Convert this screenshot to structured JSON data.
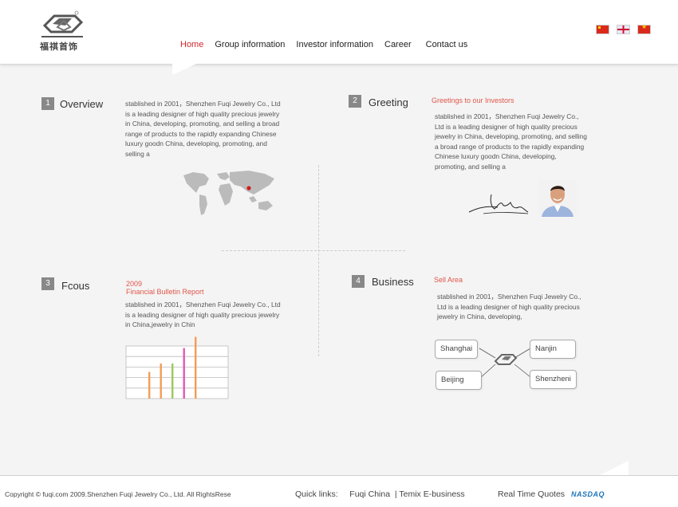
{
  "header": {
    "logo_text": "福祺首饰",
    "nav": [
      "Home",
      "Group information",
      "Investor information",
      "Career",
      "Contact us"
    ],
    "active_nav": "Home",
    "flags": [
      "china-flag-icon",
      "uk-flag-icon",
      "vietnam-flag-icon"
    ]
  },
  "sections": {
    "overview": {
      "number": "1",
      "title": "Overview",
      "text": "stablished in 2001，Shenzhen Fuqi Jewelry Co., Ltd is a leading designer of high quality precious jewelry in China, developing, promoting, and selling a broad range of products to the rapidly expanding Chinese luxury goodn China, developing, promoting, and selling a"
    },
    "greeting": {
      "number": "2",
      "title": "Greeting",
      "subtitle": "Greetings to our Investors",
      "text": "stablished in 2001，Shenzhen Fuqi Jewelry Co., Ltd is a leading designer of high quality precious jewelry in China, developing, promoting, and selling a broad range of products to the rapidly expanding Chinese luxury goodn China, developing, promoting, and selling a"
    },
    "focus": {
      "number": "3",
      "title": "Fcous",
      "year": "2009",
      "subtitle": "Financial Bulletin Report",
      "text": "stablished in 2001，Shenzhen Fuqi Jewelry Co., Ltd is a leading designer of high quality precious jewelry in China,jewelry in Chin"
    },
    "business": {
      "number": "4",
      "title": "Business",
      "subtitle": "Sell Area",
      "text": "stablished in 2001，Shenzhen Fuqi Jewelry Co., Ltd is a leading designer of high quality precious jewelry in China, developing,",
      "cities": [
        "Shanghai",
        "Nanjin",
        "Beijing",
        "Shenzheni"
      ]
    }
  },
  "chart_data": {
    "type": "bar",
    "bar_values": [
      0.38,
      0.5,
      0.5,
      0.72,
      0.88
    ],
    "bar_colors": [
      "#f39c56",
      "#f39c56",
      "#9cc95a",
      "#e05ab0",
      "#f39c56"
    ]
  },
  "footer": {
    "copyright": "Copyright © fuqi.com  2009.Shenzhen Fuqi Jewelry Co., Ltd.  All RightsRese",
    "quick_links_label": "Quick links:",
    "link1": "Fuqi China",
    "separator": "|",
    "link2": "Temix E-business",
    "quotes_label": "Real Time Quotes",
    "nasdaq": "NASDAQ"
  }
}
